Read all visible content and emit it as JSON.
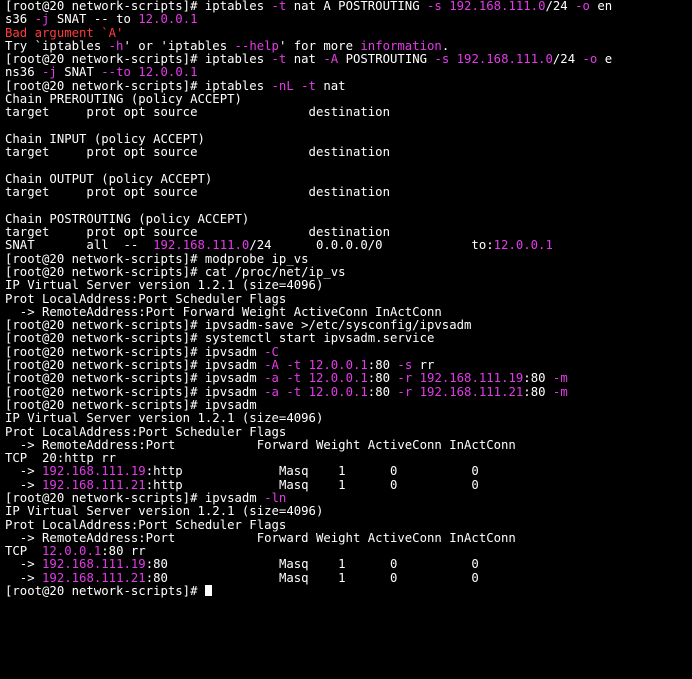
{
  "colors": {
    "text": "#ffffff",
    "background": "#000000",
    "accent": "#e33be8",
    "error": "#ff3b3b"
  },
  "terminal": {
    "lines": [
      [
        [
          "[root@20 network-scripts]# iptables ",
          "w"
        ],
        [
          "-t",
          "m"
        ],
        [
          " nat A POSTROUTING ",
          "w"
        ],
        [
          "-s",
          "m"
        ],
        [
          " ",
          "w"
        ],
        [
          "192.168.111.0",
          "m"
        ],
        [
          "/24 ",
          "w"
        ],
        [
          "-o",
          "m"
        ],
        [
          " en",
          "w"
        ]
      ],
      [
        [
          "s36 ",
          "w"
        ],
        [
          "-j",
          "m"
        ],
        [
          " SNAT -- to ",
          "w"
        ],
        [
          "12.0.0.1",
          "m"
        ]
      ],
      [
        [
          "Bad argument `A'",
          "r"
        ]
      ],
      [
        [
          "Try `iptables ",
          "w"
        ],
        [
          "-h",
          "m"
        ],
        [
          "' or 'iptables ",
          "w"
        ],
        [
          "--help",
          "m"
        ],
        [
          "' for more ",
          "w"
        ],
        [
          "information",
          "m"
        ],
        [
          ".",
          "w"
        ]
      ],
      [
        [
          "[root@20 network-scripts]# iptables ",
          "w"
        ],
        [
          "-t",
          "m"
        ],
        [
          " nat ",
          "w"
        ],
        [
          "-A",
          "m"
        ],
        [
          " POSTROUTING ",
          "w"
        ],
        [
          "-s",
          "m"
        ],
        [
          " ",
          "w"
        ],
        [
          "192.168.111.0",
          "m"
        ],
        [
          "/24 ",
          "w"
        ],
        [
          "-o",
          "m"
        ],
        [
          " e",
          "w"
        ]
      ],
      [
        [
          "ns36 ",
          "w"
        ],
        [
          "-j",
          "m"
        ],
        [
          " SNAT ",
          "w"
        ],
        [
          "--to",
          "m"
        ],
        [
          " ",
          "w"
        ],
        [
          "12.0.0.1",
          "m"
        ]
      ],
      [
        [
          "[root@20 network-scripts]# iptables ",
          "w"
        ],
        [
          "-nL",
          "m"
        ],
        [
          " ",
          "w"
        ],
        [
          "-t",
          "m"
        ],
        [
          " nat",
          "w"
        ]
      ],
      [
        [
          "Chain PREROUTING (policy ACCEPT)",
          "w"
        ]
      ],
      [
        [
          "target     prot opt source               destination",
          "w"
        ]
      ],
      [
        [
          "",
          "w"
        ]
      ],
      [
        [
          "Chain INPUT (policy ACCEPT)",
          "w"
        ]
      ],
      [
        [
          "target     prot opt source               destination",
          "w"
        ]
      ],
      [
        [
          "",
          "w"
        ]
      ],
      [
        [
          "Chain OUTPUT (policy ACCEPT)",
          "w"
        ]
      ],
      [
        [
          "target     prot opt source               destination",
          "w"
        ]
      ],
      [
        [
          "",
          "w"
        ]
      ],
      [
        [
          "Chain POSTROUTING (policy ACCEPT)",
          "w"
        ]
      ],
      [
        [
          "target     prot opt source               destination",
          "w"
        ]
      ],
      [
        [
          "SNAT       all  --  ",
          "w"
        ],
        [
          "192.168.111.0",
          "m"
        ],
        [
          "/24      0.0.0.0/0            to:",
          "w"
        ],
        [
          "12.0.0.1",
          "m"
        ]
      ],
      [
        [
          "[root@20 network-scripts]# modprobe ip_vs",
          "w"
        ]
      ],
      [
        [
          "[root@20 network-scripts]# cat /proc/net/ip_vs",
          "w"
        ]
      ],
      [
        [
          "IP Virtual Server version 1.2.1 (size=4096)",
          "w"
        ]
      ],
      [
        [
          "Prot LocalAddress:Port Scheduler Flags",
          "w"
        ]
      ],
      [
        [
          "  -> RemoteAddress:Port Forward Weight ActiveConn InActConn",
          "w"
        ]
      ],
      [
        [
          "[root@20 network-scripts]# ipvsadm-save >/etc/sysconfig/ipvsadm",
          "w"
        ]
      ],
      [
        [
          "[root@20 network-scripts]# systemctl start ipvsadm.service",
          "w"
        ]
      ],
      [
        [
          "[root@20 network-scripts]# ipvsadm ",
          "w"
        ],
        [
          "-C",
          "m"
        ]
      ],
      [
        [
          "[root@20 network-scripts]# ipvsadm ",
          "w"
        ],
        [
          "-A",
          "m"
        ],
        [
          " ",
          "w"
        ],
        [
          "-t",
          "m"
        ],
        [
          " ",
          "w"
        ],
        [
          "12.0.0.1",
          "m"
        ],
        [
          ":80 ",
          "w"
        ],
        [
          "-s",
          "m"
        ],
        [
          " rr",
          "w"
        ]
      ],
      [
        [
          "[root@20 network-scripts]# ipvsadm ",
          "w"
        ],
        [
          "-a",
          "m"
        ],
        [
          " ",
          "w"
        ],
        [
          "-t",
          "m"
        ],
        [
          " ",
          "w"
        ],
        [
          "12.0.0.1",
          "m"
        ],
        [
          ":80 ",
          "w"
        ],
        [
          "-r",
          "m"
        ],
        [
          " ",
          "w"
        ],
        [
          "192.168.111.19",
          "m"
        ],
        [
          ":80 ",
          "w"
        ],
        [
          "-m",
          "m"
        ]
      ],
      [
        [
          "[root@20 network-scripts]# ipvsadm ",
          "w"
        ],
        [
          "-a",
          "m"
        ],
        [
          " ",
          "w"
        ],
        [
          "-t",
          "m"
        ],
        [
          " ",
          "w"
        ],
        [
          "12.0.0.1",
          "m"
        ],
        [
          ":80 ",
          "w"
        ],
        [
          "-r",
          "m"
        ],
        [
          " ",
          "w"
        ],
        [
          "192.168.111.21",
          "m"
        ],
        [
          ":80 ",
          "w"
        ],
        [
          "-m",
          "m"
        ]
      ],
      [
        [
          "[root@20 network-scripts]# ipvsadm",
          "w"
        ]
      ],
      [
        [
          "IP Virtual Server version 1.2.1 (size=4096)",
          "w"
        ]
      ],
      [
        [
          "Prot LocalAddress:Port Scheduler Flags",
          "w"
        ]
      ],
      [
        [
          "  -> RemoteAddress:Port           Forward Weight ActiveConn InActConn",
          "w"
        ]
      ],
      [
        [
          "TCP  20:http rr",
          "w"
        ]
      ],
      [
        [
          "  -> ",
          "w"
        ],
        [
          "192.168.111.19",
          "m"
        ],
        [
          ":http             Masq    1      0          0",
          "w"
        ]
      ],
      [
        [
          "  -> ",
          "w"
        ],
        [
          "192.168.111.21",
          "m"
        ],
        [
          ":http             Masq    1      0          0",
          "w"
        ]
      ],
      [
        [
          "[root@20 network-scripts]# ipvsadm ",
          "w"
        ],
        [
          "-ln",
          "m"
        ]
      ],
      [
        [
          "IP Virtual Server version 1.2.1 (size=4096)",
          "w"
        ]
      ],
      [
        [
          "Prot LocalAddress:Port Scheduler Flags",
          "w"
        ]
      ],
      [
        [
          "  -> RemoteAddress:Port           Forward Weight ActiveConn InActConn",
          "w"
        ]
      ],
      [
        [
          "TCP  ",
          "w"
        ],
        [
          "12.0.0.1",
          "m"
        ],
        [
          ":80 rr",
          "w"
        ]
      ],
      [
        [
          "  -> ",
          "w"
        ],
        [
          "192.168.111.19",
          "m"
        ],
        [
          ":80               Masq    1      0          0",
          "w"
        ]
      ],
      [
        [
          "  -> ",
          "w"
        ],
        [
          "192.168.111.21",
          "m"
        ],
        [
          ":80               Masq    1      0          0",
          "w"
        ]
      ],
      [
        [
          "[root@20 network-scripts]# ",
          "w"
        ]
      ]
    ]
  }
}
